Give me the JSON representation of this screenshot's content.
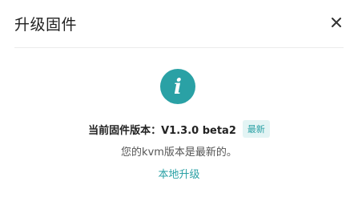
{
  "dialog": {
    "title": "升级固件",
    "close_icon": "close-icon"
  },
  "firmware": {
    "icon": "info-icon",
    "icon_glyph": "i",
    "version_label": "当前固件版本：V1.3.0 beta2",
    "latest_badge": "最新",
    "status_text": "您的kvm版本是最新的。",
    "local_upgrade_link": "本地升级"
  },
  "colors": {
    "accent": "#2aa1a5",
    "badge_bg": "#e3f4f4"
  }
}
